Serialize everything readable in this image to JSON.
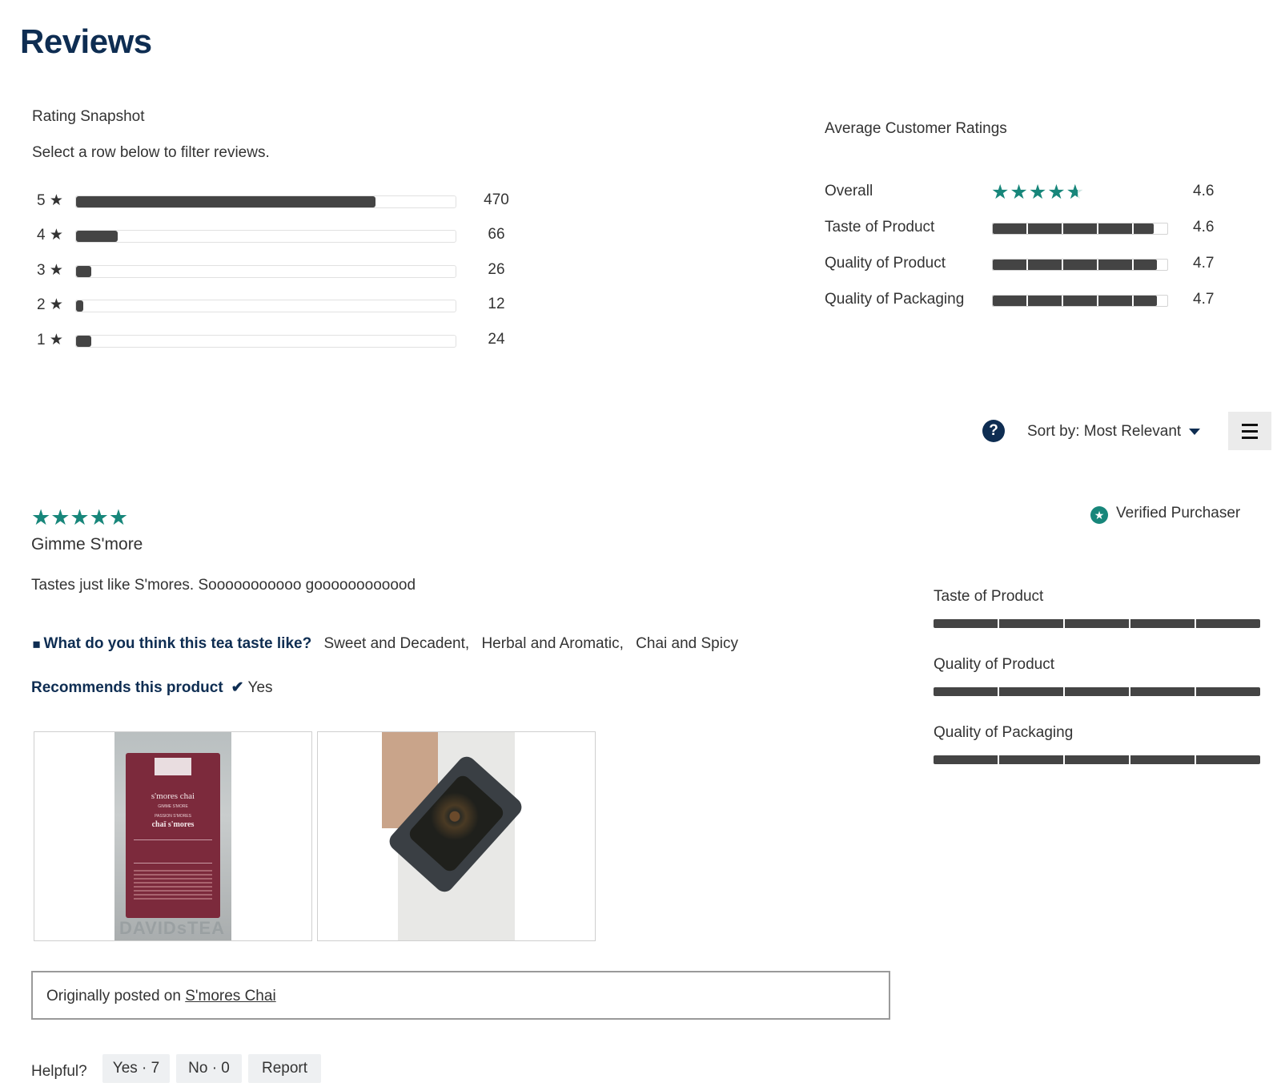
{
  "page_title": "Reviews",
  "snapshot": {
    "title": "Rating Snapshot",
    "hint": "Select a row below to filter reviews.",
    "rows": [
      {
        "label": "5 ★",
        "count": "470",
        "share": 0.79
      },
      {
        "label": "4 ★",
        "count": "66",
        "share": 0.11
      },
      {
        "label": "3 ★",
        "count": "26",
        "share": 0.04
      },
      {
        "label": "2 ★",
        "count": "12",
        "share": 0.02
      },
      {
        "label": "1 ★",
        "count": "24",
        "share": 0.04
      }
    ]
  },
  "average": {
    "title": "Average Customer Ratings",
    "overall": {
      "label": "Overall",
      "value": "4.6",
      "stars": 4.6
    },
    "items": [
      {
        "label": "Taste of Product",
        "value": "4.6",
        "fill": 0.92
      },
      {
        "label": "Quality of Product",
        "value": "4.7",
        "fill": 0.94
      },
      {
        "label": "Quality of Packaging",
        "value": "4.7",
        "fill": 0.94
      }
    ]
  },
  "controls": {
    "help_icon": "question-icon",
    "help_glyph": "?",
    "sort_label": "Sort by: Most Relevant",
    "filter_icon": "hamburger-menu-icon"
  },
  "review": {
    "rating": 5,
    "stars_text": "★★★★★",
    "title": "Gimme S'more",
    "body": "Tastes just like S'mores. Sooooooooooo goooooooooood",
    "verified_label": "Verified Purchaser",
    "taste_question": "What do you think this tea taste like?",
    "taste_answers": [
      "Sweet and Decadent,",
      "Herbal and Aromatic,",
      "Chai and Spicy"
    ],
    "recommend_label": "Recommends this product",
    "recommend_check": "✔",
    "recommend_value": "Yes",
    "photo_1": {
      "brand": "DAVIDsTEA",
      "line1": "s'mores chai",
      "line2": "GIMME S'MORE",
      "line3": "PASSION S'MORES",
      "line4": "chaï s'mores"
    },
    "sub_ratings": [
      {
        "label": "Taste of Product",
        "value": 5
      },
      {
        "label": "Quality of Product",
        "value": 5
      },
      {
        "label": "Quality of Packaging",
        "value": 5
      }
    ],
    "origin_prefix": "Originally posted on ",
    "origin_link": "S'mores Chai",
    "helpful_label": "Helpful?",
    "yes_label": "Yes · 7",
    "no_label": "No · 0",
    "report_label": "Report"
  },
  "colors": {
    "brand_navy": "#0e2d52",
    "accent_teal": "#17867a",
    "bar_fill": "#444444"
  }
}
